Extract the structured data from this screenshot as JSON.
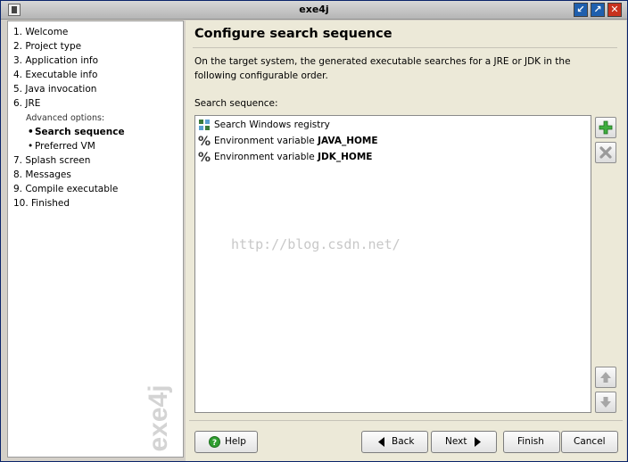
{
  "window": {
    "title": "exe4j",
    "minimize": "↙",
    "maximize": "↗",
    "close": "✕"
  },
  "sidebar": {
    "steps": [
      {
        "label": "1. Welcome"
      },
      {
        "label": "2. Project type"
      },
      {
        "label": "3. Application info"
      },
      {
        "label": "4. Executable info"
      },
      {
        "label": "5. Java invocation"
      },
      {
        "label": "6. JRE"
      },
      {
        "label": "Advanced options:"
      },
      {
        "label": "Search sequence"
      },
      {
        "label": "Preferred VM"
      },
      {
        "label": "7. Splash screen"
      },
      {
        "label": "8. Messages"
      },
      {
        "label": "9. Compile executable"
      },
      {
        "label": "10. Finished"
      }
    ],
    "brand": "exe4j"
  },
  "page": {
    "heading": "Configure search sequence",
    "description": "On the target system, the generated executable searches for a JRE or JDK in the following configurable order.",
    "sequence_label": "Search sequence:",
    "watermark": "http://blog.csdn.net/",
    "sequence": [
      {
        "icon": "registry-icon",
        "text": "Search Windows registry",
        "bold": ""
      },
      {
        "icon": "percent-icon",
        "text": "Environment variable ",
        "bold": "JAVA_HOME"
      },
      {
        "icon": "percent-icon",
        "text": "Environment variable ",
        "bold": "JDK_HOME"
      }
    ]
  },
  "colors": {
    "add": "#2f9e2f",
    "remove": "#9a9a9a",
    "accent": "#0a246a"
  },
  "buttons": {
    "help": "Help",
    "back": "Back",
    "next": "Next",
    "finish": "Finish",
    "cancel": "Cancel"
  }
}
